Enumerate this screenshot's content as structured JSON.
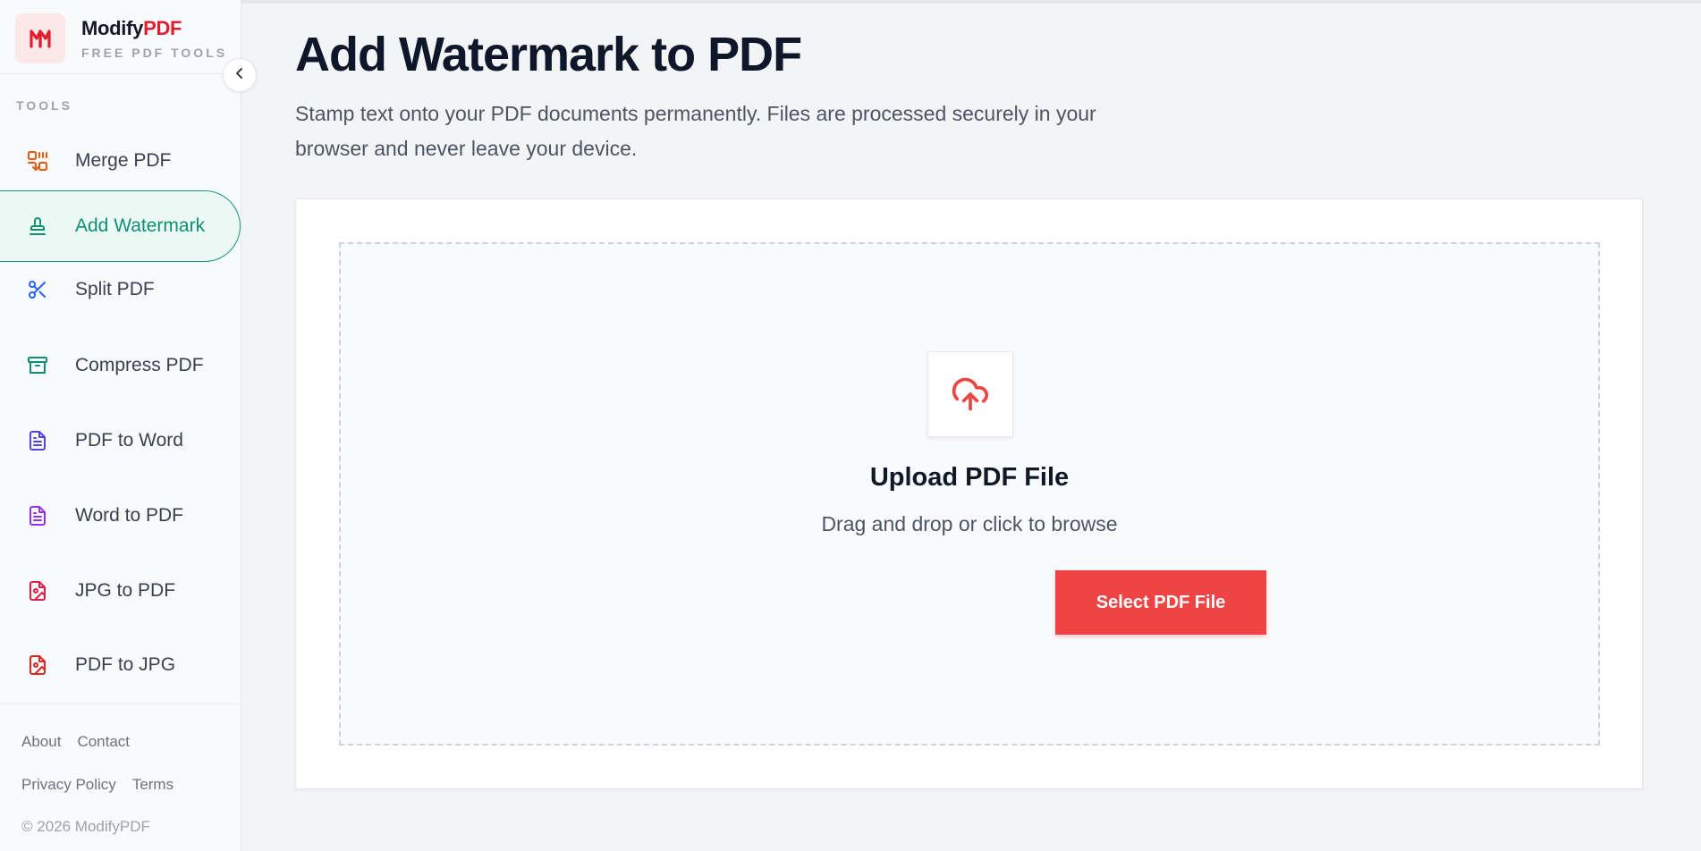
{
  "brand": {
    "name_main": "Modify",
    "name_accent": "PDF",
    "tagline": "FREE PDF TOOLS"
  },
  "sidebar": {
    "section_label": "TOOLS",
    "items": [
      {
        "label": "Merge PDF",
        "icon": "merge-icon",
        "color": "#ea580c"
      },
      {
        "label": "Add Watermark",
        "icon": "stamp-icon",
        "color": "#0f8f72",
        "active": true
      },
      {
        "label": "Split PDF",
        "icon": "scissors-icon",
        "color": "#2563eb"
      },
      {
        "label": "Compress PDF",
        "icon": "archive-icon",
        "color": "#0f8f72"
      },
      {
        "label": "PDF to Word",
        "icon": "document-icon",
        "color": "#4f46e5"
      },
      {
        "label": "Word to PDF",
        "icon": "document-icon",
        "color": "#9333ea"
      },
      {
        "label": "JPG to PDF",
        "icon": "image-file-icon",
        "color": "#e11d48"
      },
      {
        "label": "PDF to JPG",
        "icon": "image-file-icon",
        "color": "#dc2626"
      }
    ],
    "footer": {
      "links_row1": [
        "About",
        "Contact"
      ],
      "links_row2": [
        "Privacy Policy",
        "Terms"
      ],
      "copyright": "© 2026 ModifyPDF"
    }
  },
  "main": {
    "title": "Add Watermark to PDF",
    "description": "Stamp text onto your PDF documents permanently. Files are processed securely in your browser and never leave your device.",
    "upload": {
      "title": "Upload PDF File",
      "subtitle": "Drag and drop or click to browse",
      "button_label": "Select PDF File"
    }
  },
  "colors": {
    "accent": "#ef4444",
    "active": "#0f8f72",
    "brand": "#e11d2e"
  }
}
